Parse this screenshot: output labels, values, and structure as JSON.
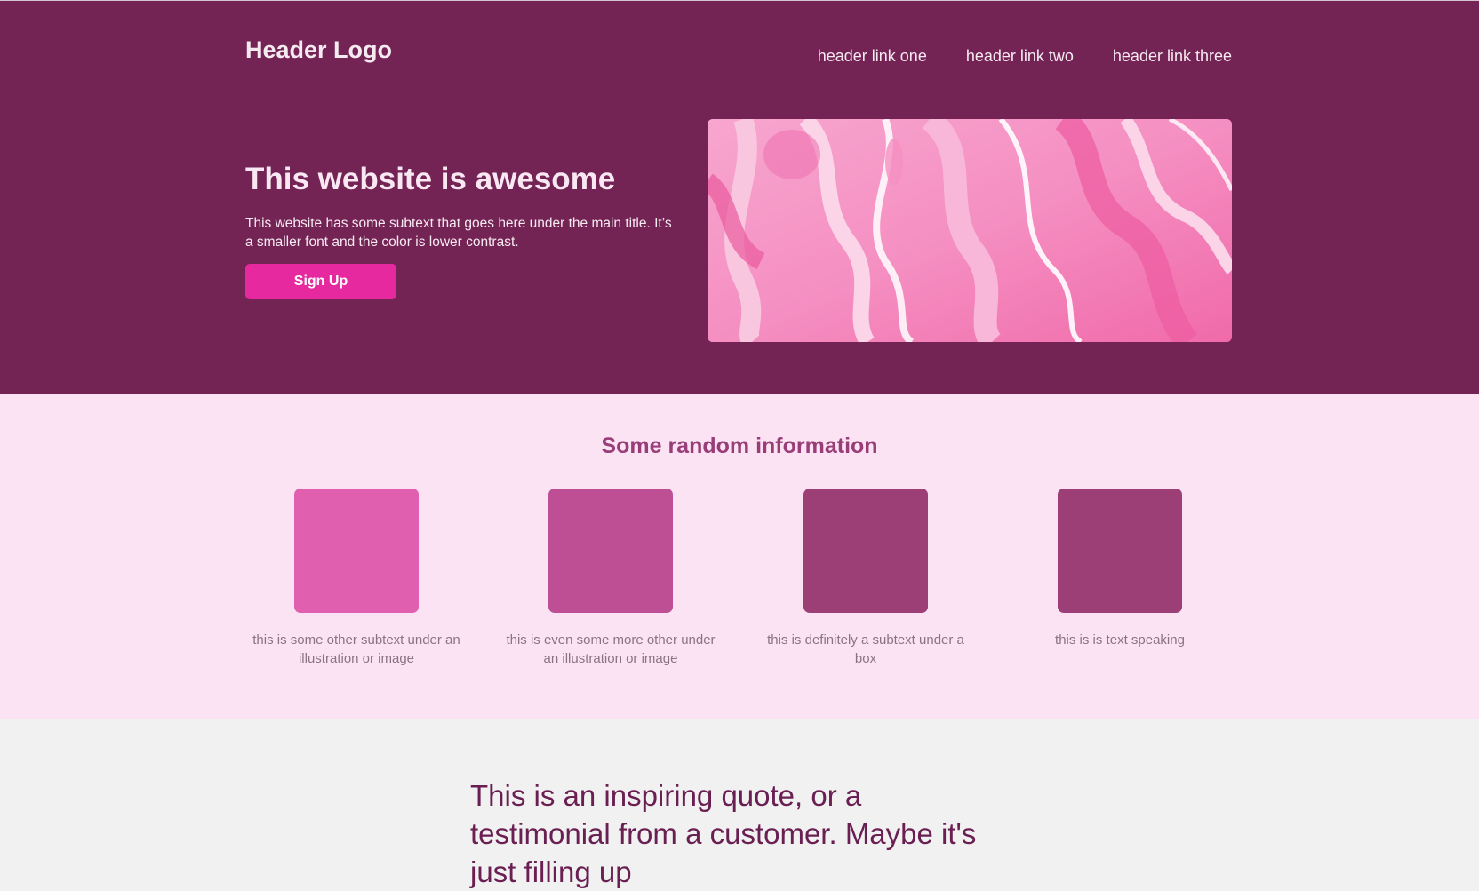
{
  "header": {
    "logo": "Header Logo",
    "links": [
      "header link one",
      "header link two",
      "header link three"
    ]
  },
  "hero": {
    "title": "This website is awesome",
    "subtext": "This website has some subtext that goes here under the main title. It’s a smaller font and the color is lower contrast.",
    "button_label": "Sign Up"
  },
  "info": {
    "title": "Some random information",
    "cards": [
      {
        "caption": "this is some other subtext under an illustration or image",
        "color": "#e05fae"
      },
      {
        "caption": "this is even some more other under an illustration or image",
        "color": "#bf4f94"
      },
      {
        "caption": "this is definitely a subtext under a box",
        "color": "#9c3f77"
      },
      {
        "caption": "this is is text speaking",
        "color": "#9c3f77"
      }
    ]
  },
  "quote": {
    "text": "This is an inspiring quote, or a testimonial from a customer. Maybe it's just filling up"
  },
  "colors": {
    "hero_bg": "#732354",
    "accent": "#e6299f",
    "info_bg": "#fce3f4",
    "quote_bg": "#f1f1f1"
  }
}
